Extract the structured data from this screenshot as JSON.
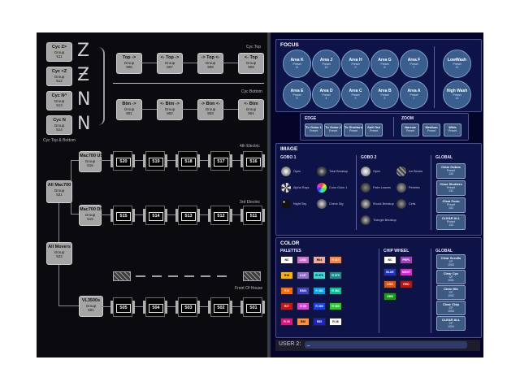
{
  "left": {
    "cyc_groups": [
      {
        "name": "Cyc Z>",
        "type": "Group",
        "num": "511"
      },
      {
        "name": "Cyc <Z",
        "type": "Group",
        "num": "512"
      },
      {
        "name": "Cyc N^",
        "type": "Group",
        "num": "513"
      },
      {
        "name": "Cyc N",
        "type": "Group",
        "num": "514"
      }
    ],
    "cyc_label": "Cyc Top & Bottom",
    "cyc_top_label": "Cyc Top",
    "cyc_bottom_label": "Cyc Bottom",
    "top_groups": [
      {
        "name": "Top ->",
        "type": "Group",
        "num": "906"
      },
      {
        "name": "<- Top ->",
        "type": "Group",
        "num": "907"
      },
      {
        "name": "-> Top <-",
        "type": "Group",
        "num": "908"
      },
      {
        "name": "<- Top",
        "type": "Group",
        "num": "909"
      }
    ],
    "btm_groups": [
      {
        "name": "Btm ->",
        "type": "Group",
        "num": "901"
      },
      {
        "name": "<- Btm ->",
        "type": "Group",
        "num": "902"
      },
      {
        "name": "-> Btm <-",
        "type": "Group",
        "num": "903"
      },
      {
        "name": "<- Btm",
        "type": "Group",
        "num": "904"
      }
    ],
    "elec4_label": "4th Electric",
    "elec3_label": "3rd Electric",
    "foh_label": "Front Of House",
    "mac_us": {
      "name": "Mac700 US",
      "type": "Group",
      "num": "516"
    },
    "mac_ds": {
      "name": "Mac700 DS",
      "type": "Group",
      "num": "515"
    },
    "all_mac": {
      "name": "All Mac700",
      "type": "Group",
      "num": "521"
    },
    "all_movers": {
      "name": "All Movers",
      "type": "Group",
      "num": "522"
    },
    "vl": {
      "name": "VL3500s",
      "type": "Group",
      "num": "501"
    },
    "row_us": [
      "520",
      "519",
      "518",
      "517",
      "516"
    ],
    "row_ds": [
      "515",
      "514",
      "513",
      "512",
      "511"
    ],
    "row_foh": [
      "505",
      "504",
      "503",
      "502",
      "501"
    ]
  },
  "focus": {
    "title": "FOCUS",
    "row1": [
      {
        "name": "Area K",
        "sub": "Preset",
        "num": "11"
      },
      {
        "name": "Area J",
        "sub": "Preset",
        "num": "10"
      },
      {
        "name": "Area H",
        "sub": "Preset",
        "num": "9"
      },
      {
        "name": "Area G",
        "sub": "Preset",
        "num": "8"
      },
      {
        "name": "Area F",
        "sub": "Preset",
        "num": "7"
      }
    ],
    "row2": [
      {
        "name": "Area E",
        "sub": "Preset",
        "num": "5"
      },
      {
        "name": "Area D",
        "sub": "Preset",
        "num": "4"
      },
      {
        "name": "Area C",
        "sub": "Preset",
        "num": "3"
      },
      {
        "name": "Area B",
        "sub": "Preset",
        "num": "2"
      },
      {
        "name": "Area A",
        "sub": "Preset",
        "num": "1"
      }
    ],
    "low_wash": {
      "name": "LowWash",
      "sub": "Preset",
      "num": "12"
    },
    "high_wash": {
      "name": "High Wash",
      "sub": "Preset",
      "num": "13"
    }
  },
  "edge": {
    "title": "EDGE",
    "buttons": [
      {
        "name": "To Gobo 1",
        "sub": "Preset"
      },
      {
        "name": "To Gobo 2",
        "sub": "Preset"
      },
      {
        "name": "To Shutters",
        "sub": "Preset"
      },
      {
        "name": "Soft Out",
        "sub": "Preset"
      }
    ]
  },
  "zoom": {
    "title": "ZOOM",
    "buttons": [
      {
        "name": "Narrow",
        "sub": "Preset"
      },
      {
        "name": "Medium",
        "sub": "Preset"
      },
      {
        "name": "Wide",
        "sub": "Preset"
      }
    ]
  },
  "image": {
    "title": "IMAGE",
    "gobo1_title": "GOBO 1",
    "gobo2_title": "GOBO 2",
    "global_title": "GLOBAL",
    "gobo1": [
      "Open",
      "Total Breakup",
      "Alpha Rays",
      "Color Gobo 1",
      "Night Sky",
      "Check Dig"
    ],
    "gobo2": [
      "Open",
      "Ice Blocks",
      "Palm Leaves",
      "Pebbles",
      "Shock Breakup",
      "Cells",
      "Triangle Breakup"
    ],
    "global_buttons": [
      {
        "name": "Clear Gobos",
        "sub": "Preset",
        "num": "130"
      },
      {
        "name": "Clear Shutters",
        "sub": "Preset",
        "num": "131"
      },
      {
        "name": "Clear Form",
        "sub": "Preset",
        "num": "132"
      },
      {
        "name": "CLEAR ALL",
        "sub": "Preset",
        "num": "133"
      }
    ]
  },
  "color": {
    "title": "COLOR",
    "palettes_title": "PALETTES",
    "chip_title": "CHIP WHEEL",
    "global_title": "GLOBAL",
    "palettes": [
      [
        {
          "t": "NC",
          "c": "#ffffff",
          "f": "#000000"
        },
        {
          "t": "L052",
          "c": "#d070d0",
          "f": "#ffffff"
        },
        {
          "t": "R04",
          "c": "#f0a8a0",
          "f": "#000000"
        },
        {
          "t": "R 319",
          "c": "#ff8040",
          "f": "#ffffff"
        }
      ],
      [
        {
          "t": "R18",
          "c": "#ffb000",
          "f": "#000000"
        },
        {
          "t": "L137",
          "c": "#9070d0",
          "f": "#ffffff"
        },
        {
          "t": "R 373",
          "c": "#30e0e0",
          "f": "#000000"
        },
        {
          "t": "R 379",
          "c": "#109090",
          "f": "#ffffff"
        }
      ],
      [
        {
          "t": "R19",
          "c": "#ff6a00",
          "f": "#ffffff"
        },
        {
          "t": "R363",
          "c": "#4040d0",
          "f": "#ffffff"
        },
        {
          "t": "R 380",
          "c": "#00a0ff",
          "f": "#ffffff"
        },
        {
          "t": "R 383",
          "c": "#00c0a0",
          "f": "#ffffff"
        }
      ],
      [
        {
          "t": "R27",
          "c": "#d01010",
          "f": "#ffffff"
        },
        {
          "t": "R 36",
          "c": "#e040e0",
          "f": "#ffffff"
        },
        {
          "t": "R 385",
          "c": "#1040ff",
          "f": "#ffffff"
        },
        {
          "t": "R 389",
          "c": "#20d020",
          "f": "#ffffff"
        }
      ],
      [
        {
          "t": "R 46",
          "c": "#e01080",
          "f": "#ffffff"
        },
        {
          "t": "R40",
          "c": "#ff9040",
          "f": "#000000"
        },
        {
          "t": "R85",
          "c": "#2020c0",
          "f": "#ffffff"
        },
        {
          "t": "R 26",
          "c": "#ffffff",
          "f": "#000000"
        }
      ]
    ],
    "chip": [
      [
        {
          "t": "NC",
          "c": "#ffffff",
          "f": "#000000"
        },
        {
          "t": "PRPL",
          "c": "#a040c0",
          "f": "#ffffff"
        }
      ],
      [
        {
          "t": "BLUE",
          "c": "#2030d0",
          "f": "#ffffff"
        },
        {
          "t": "MGNT",
          "c": "#e020e0",
          "f": "#ffffff"
        }
      ],
      [
        {
          "t": "ORG",
          "c": "#e05010",
          "f": "#ffffff"
        },
        {
          "t": "RED",
          "c": "#c01010",
          "f": "#ffffff"
        }
      ],
      [
        {
          "t": "GRN",
          "c": "#10a010",
          "f": "#ffffff"
        }
      ]
    ],
    "global_buttons": [
      {
        "name": "Clear Scrolls",
        "sub": "CP",
        "num": "1000"
      },
      {
        "name": "Clear Cyc",
        "sub": "CP",
        "num": "1001"
      },
      {
        "name": "Clear Mix",
        "sub": "CP",
        "num": "1002"
      },
      {
        "name": "Clear Chip",
        "sub": "CP",
        "num": "1003"
      },
      {
        "name": "CLEAR ALL",
        "sub": "CP",
        "num": "1004"
      }
    ]
  },
  "user": {
    "label": "USER 2:",
    "value": "_"
  }
}
